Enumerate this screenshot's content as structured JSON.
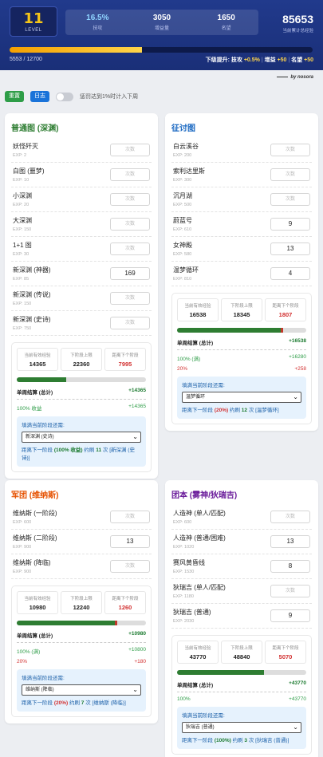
{
  "header": {
    "level": "11",
    "level_label": "LEVEL",
    "stats": [
      {
        "value": "16.5%",
        "label": "技攻",
        "accent": true
      },
      {
        "value": "3050",
        "label": "增益量",
        "accent": false
      },
      {
        "value": "1650",
        "label": "名望",
        "accent": false
      }
    ],
    "total_value": "85653",
    "total_label": "当前累计总经验",
    "xp_text": "5553 / 12700",
    "xp_progress": 0.437,
    "next_prefix": "下级提升: 技攻",
    "next_items": [
      "+0.5%",
      "增益",
      "+50",
      "名望",
      "+50"
    ]
  },
  "byline": "by nosora",
  "controls": {
    "reset_label": "重置",
    "log_label": "日志",
    "toggle_label": "惩罚达到1%时计入下周",
    "toggle_on": false
  },
  "colors": {
    "green_title": "#2e7d32",
    "blue_title": "#1565c0",
    "orange_title": "#e65100",
    "purple_title": "#6a1b9a"
  },
  "cards": [
    {
      "title": "普通图 (深渊)",
      "title_color": "#2e7d32",
      "rows": [
        {
          "name": "妖怪歼灭",
          "exp": "EXP: 2",
          "count": "",
          "placeholder": "次数"
        },
        {
          "name": "白图 (噩梦)",
          "exp": "EXP: 10",
          "count": "",
          "placeholder": "次数"
        },
        {
          "name": "小深渊",
          "exp": "EXP: 20",
          "count": "",
          "placeholder": "次数"
        },
        {
          "name": "大深渊",
          "exp": "EXP: 150",
          "count": "",
          "placeholder": "次数"
        },
        {
          "name": "1+1 图",
          "exp": "EXP: 30",
          "count": "",
          "placeholder": "次数"
        },
        {
          "name": "新深渊 (神器)",
          "exp": "EXP: 85",
          "count": "169",
          "placeholder": "次数"
        },
        {
          "name": "新深渊 (传说)",
          "exp": "EXP: 150",
          "count": "",
          "placeholder": "次数"
        },
        {
          "name": "新深渊 (史诗)",
          "exp": "EXP: 750",
          "count": "",
          "placeholder": "次数"
        }
      ],
      "summary": {
        "current_label": "当前有效经验",
        "current": "14365",
        "cap_label": "下阶段上限",
        "cap": "22360",
        "dist_label": "距离下个阶段",
        "dist": "7995",
        "progress_green": 0.38,
        "progress_red": 0,
        "total_label": "单周结算 (总计)",
        "total": "+14365",
        "lines": [
          {
            "label": "100% 收益",
            "value": "+14365",
            "color": "green"
          }
        ],
        "target_label": "填满当前阶段还需:",
        "target_select": "新深渊 (史诗)",
        "result": [
          "距离下一阶段 ",
          "(100% 收益)",
          " 约刷 ",
          "11",
          " 次 [新深渊 (史诗)]"
        ]
      }
    },
    {
      "title": "征讨图",
      "title_color": "#1565c0",
      "rows": [
        {
          "name": "白云溪谷",
          "exp": "EXP: 200",
          "count": "",
          "placeholder": "次数"
        },
        {
          "name": "索利达里斯",
          "exp": "EXP: 300",
          "count": "",
          "placeholder": "次数"
        },
        {
          "name": "沉月湖",
          "exp": "EXP: 500",
          "count": "",
          "placeholder": "次数"
        },
        {
          "name": "蔚蓝号",
          "exp": "EXP: 610",
          "count": "9",
          "placeholder": "次数"
        },
        {
          "name": "女神殿",
          "exp": "EXP: 580",
          "count": "13",
          "placeholder": "次数"
        },
        {
          "name": "温梦循环",
          "exp": "EXP: 810",
          "count": "4",
          "placeholder": "次数"
        }
      ],
      "summary": {
        "current_label": "当前有效经验",
        "current": "16538",
        "cap_label": "下阶段上限",
        "cap": "18345",
        "dist_label": "距离下个阶段",
        "dist": "1807",
        "progress_green": 0.8,
        "progress_red": 0.02,
        "total_label": "单周结算 (总计)",
        "total": "+16538",
        "lines": [
          {
            "label": "100% (满)",
            "value": "+16280",
            "color": "green"
          },
          {
            "label": "20%",
            "value": "+258",
            "color": "red"
          }
        ],
        "target_label": "填满当前阶段还需:",
        "target_select": "温梦循环",
        "result": [
          "距离下一阶段 ",
          "(20%)",
          " 约刷 ",
          "12",
          " 次 [温梦循环]"
        ]
      }
    },
    {
      "title": "军团 (维纳斯)",
      "title_color": "#e65100",
      "rows": [
        {
          "name": "维纳斯 (一阶段)",
          "exp": "EXP: 600",
          "count": "",
          "placeholder": "次数"
        },
        {
          "name": "维纳斯 (二阶段)",
          "exp": "EXP: 900",
          "count": "13",
          "placeholder": "次数"
        },
        {
          "name": "维纳斯 (降临)",
          "exp": "EXP: 900",
          "count": "",
          "placeholder": "次数"
        }
      ],
      "summary": {
        "current_label": "当前有效经验",
        "current": "10980",
        "cap_label": "下阶段上限",
        "cap": "12240",
        "dist_label": "距离下个阶段",
        "dist": "1260",
        "progress_green": 0.76,
        "progress_red": 0.02,
        "total_label": "单周结算 (总计)",
        "total": "+10980",
        "lines": [
          {
            "label": "100% (满)",
            "value": "+10800",
            "color": "green"
          },
          {
            "label": "20%",
            "value": "+180",
            "color": "red"
          }
        ],
        "target_label": "填满当前阶段还需:",
        "target_select": "维纳斯 (降临)",
        "result": [
          "距离下一阶段 ",
          "(20%)",
          " 约刷 ",
          "7",
          " 次 [维纳斯 (降临)]"
        ]
      }
    },
    {
      "title": "团本 (雾神/狄瑞吉)",
      "title_color": "#6a1b9a",
      "rows": [
        {
          "name": "人造神 (单人/匹配)",
          "exp": "EXP: 600",
          "count": "",
          "placeholder": "次数"
        },
        {
          "name": "人造神 (普通/困难)",
          "exp": "EXP: 1020",
          "count": "13",
          "placeholder": "次数"
        },
        {
          "name": "赛风黄昏线",
          "exp": "EXP: 1530",
          "count": "8",
          "placeholder": "次数"
        },
        {
          "name": "狄瑞吉 (单人/匹配)",
          "exp": "EXP: 1180",
          "count": "",
          "placeholder": "次数"
        },
        {
          "name": "狄瑞吉 (普通)",
          "exp": "EXP: 2030",
          "count": "9",
          "placeholder": "次数"
        }
      ],
      "summary": {
        "current_label": "当前有效经验",
        "current": "43770",
        "cap_label": "下阶段上限",
        "cap": "48840",
        "dist_label": "距离下个阶段",
        "dist": "5070",
        "progress_green": 0.67,
        "progress_red": 0,
        "total_label": "单周结算 (总计)",
        "total": "+43770",
        "lines": [
          {
            "label": "100%",
            "value": "+43770",
            "color": "green"
          }
        ],
        "target_label": "填满当前阶段还需:",
        "target_select": "狄瑞吉 (普通)",
        "result": [
          "距离下一阶段 ",
          "(100%)",
          " 约刷 ",
          "3",
          " 次 [狄瑞吉 (普通)]"
        ]
      }
    }
  ]
}
